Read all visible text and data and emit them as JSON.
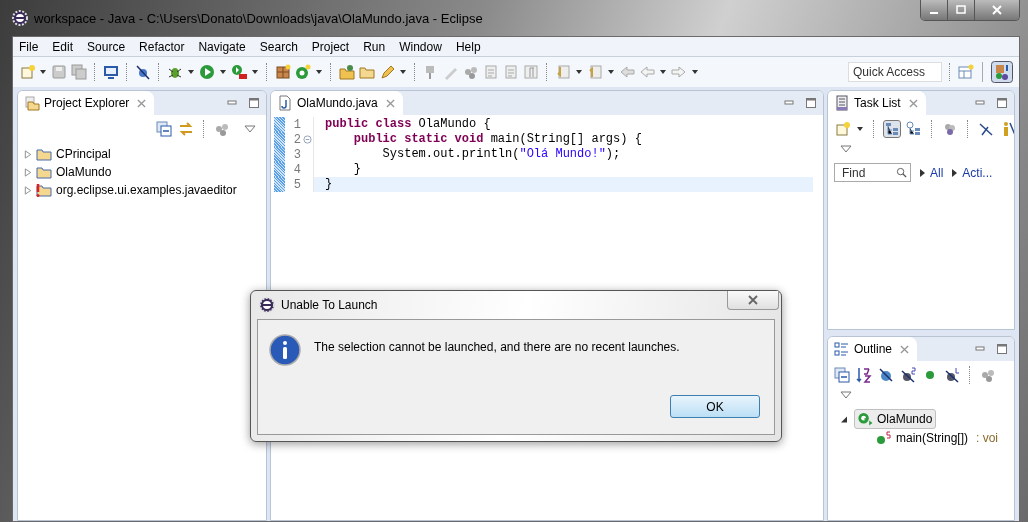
{
  "window": {
    "title": "workspace - Java - C:\\Users\\Donato\\Downloads\\java\\OlaMundo.java - Eclipse"
  },
  "menu": [
    "File",
    "Edit",
    "Source",
    "Refactor",
    "Navigate",
    "Search",
    "Project",
    "Run",
    "Window",
    "Help"
  ],
  "toolbar": {
    "quick_access": {
      "placeholder": "Quick Access"
    }
  },
  "project_explorer": {
    "title": "Project Explorer",
    "items": [
      {
        "label": "CPrincipal",
        "error": false
      },
      {
        "label": "OlaMundo",
        "error": false
      },
      {
        "label": "org.eclipse.ui.examples.javaeditor",
        "error": true
      }
    ]
  },
  "editor": {
    "tab": "OlaMundo.java",
    "lines": [
      {
        "number": "1",
        "fold": false,
        "current": false,
        "tokens": [
          {
            "kind": "keyword",
            "text": "public class"
          },
          {
            "kind": "plain",
            "text": " OlaMundo {"
          }
        ]
      },
      {
        "number": "2",
        "fold": true,
        "current": false,
        "tokens": [
          {
            "kind": "keyword",
            "text": "    public static void"
          },
          {
            "kind": "plain",
            "text": " main(String[] args) {"
          }
        ]
      },
      {
        "number": "3",
        "fold": false,
        "current": false,
        "tokens": [
          {
            "kind": "plain",
            "text": "        System.out.println("
          },
          {
            "kind": "string",
            "text": "\"Olá Mundo!\""
          },
          {
            "kind": "plain",
            "text": ");"
          }
        ]
      },
      {
        "number": "4",
        "fold": false,
        "current": false,
        "tokens": [
          {
            "kind": "plain",
            "text": "    }"
          }
        ]
      },
      {
        "number": "5",
        "fold": false,
        "current": true,
        "tokens": [
          {
            "kind": "plain",
            "text": "}"
          }
        ]
      }
    ]
  },
  "task_list": {
    "title": "Task List",
    "find": {
      "placeholder": "Find"
    },
    "filters": [
      "All",
      "Acti..."
    ]
  },
  "outline": {
    "title": "Outline",
    "items": [
      {
        "label": "OlaMundo",
        "selected": true,
        "expanded": true,
        "children": [
          {
            "label": "main(String[])",
            "return_type": ": voi"
          }
        ]
      }
    ]
  },
  "dialog": {
    "title": "Unable To Launch",
    "message": "The selection cannot be launched, and there are no recent launches.",
    "button": "OK"
  }
}
